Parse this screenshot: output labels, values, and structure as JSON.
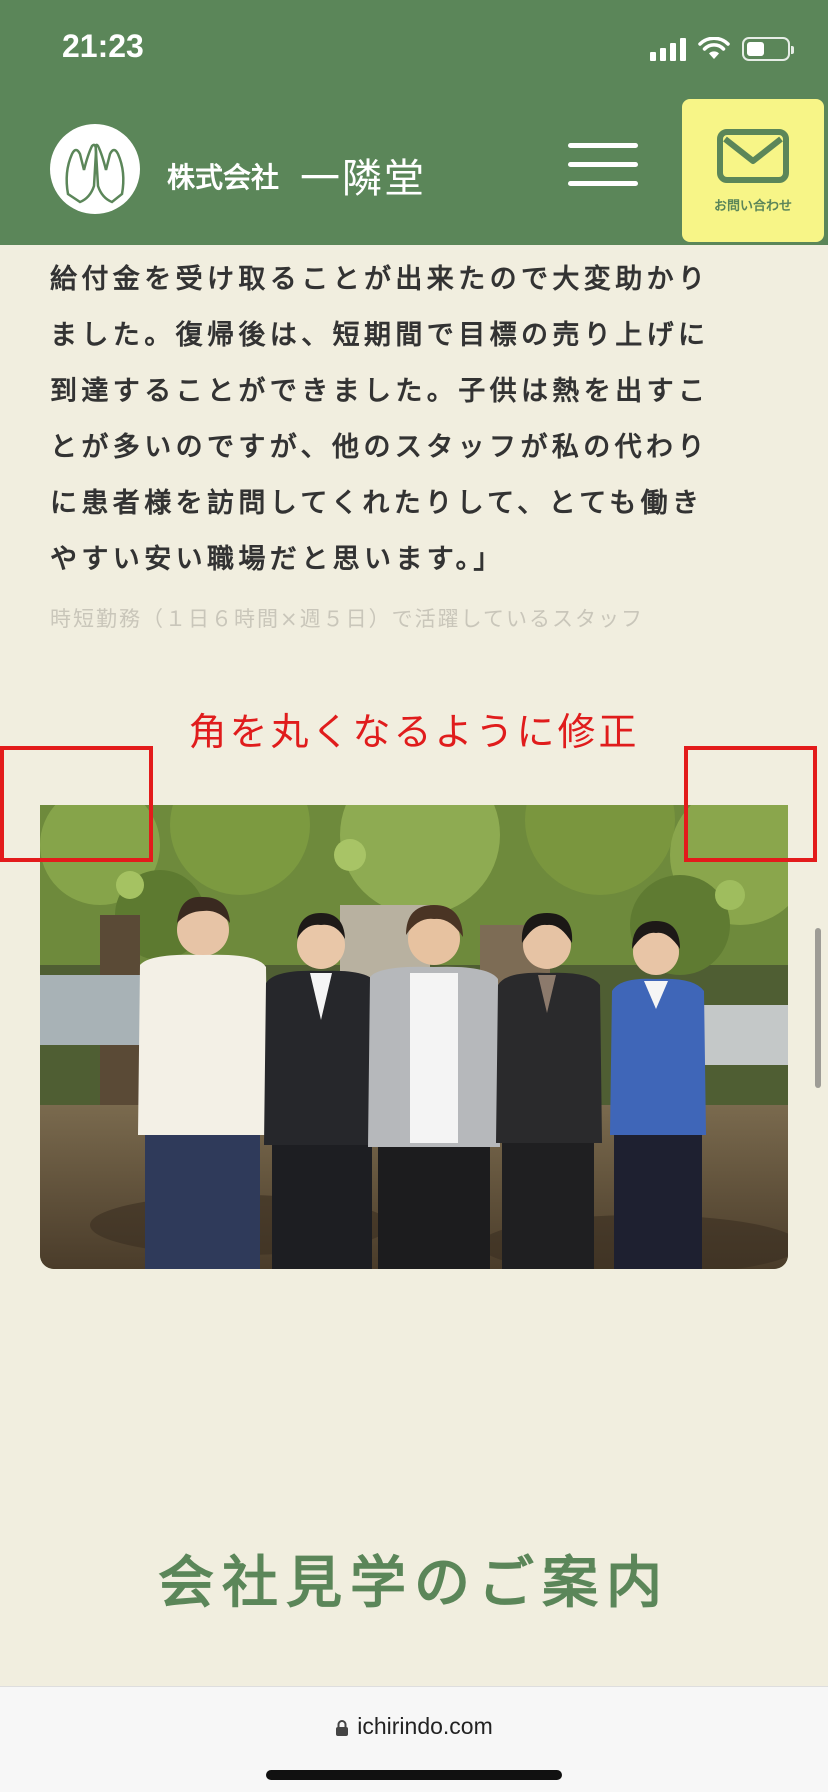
{
  "status_bar": {
    "time": "21:23"
  },
  "header": {
    "logo_prefix": "株式会社",
    "logo_name": "一隣堂",
    "contact_label": "お問い合わせ",
    "colors": {
      "header_bg": "#5b8659",
      "contact_bg": "#f7f587"
    }
  },
  "article": {
    "lines": [
      "給付金を受け取ることが出来たので大変助かり",
      "ました。復帰後は、短期間で目標の売り上げに",
      "到達することができました。子供は熱を出すこ",
      "とが多いのですが、他のスタッフが私の代わり",
      "に患者様を訪問してくれたりして、とても働き",
      "やすい安い職場だと思います。」"
    ],
    "caption": "時短勤務（１日６時間×週５日）で活躍しているスタッフ"
  },
  "annotation": {
    "text": "角を丸くなるように修正",
    "color": "#e01c1c"
  },
  "section": {
    "title": "会社見学のご案内"
  },
  "browser": {
    "url": "ichirindo.com"
  }
}
